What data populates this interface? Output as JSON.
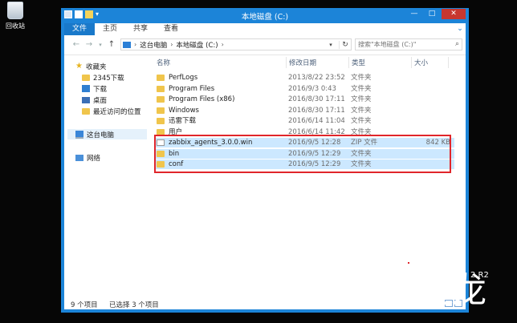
{
  "desktop": {
    "recycle_bin_label": "回收站"
  },
  "window": {
    "title": "本地磁盘 (C:)",
    "ribbon_tabs": [
      "文件",
      "主页",
      "共享",
      "查看"
    ],
    "address": {
      "crumbs": [
        "这台电脑",
        "本地磁盘 (C:)"
      ]
    },
    "search_placeholder": "搜索\"本地磁盘 (C:)\""
  },
  "nav_pane": {
    "favorites": "收藏夹",
    "items": [
      "2345下载",
      "下载",
      "桌面",
      "最近访问的位置"
    ],
    "this_pc": "这台电脑",
    "network": "网络"
  },
  "columns": {
    "name": "名称",
    "date": "修改日期",
    "type": "类型",
    "size": "大小"
  },
  "files": [
    {
      "name": "PerfLogs",
      "date": "2013/8/22 23:52",
      "type": "文件夹",
      "size": "",
      "icon": "folder-icon",
      "selected": false
    },
    {
      "name": "Program Files",
      "date": "2016/9/3 0:43",
      "type": "文件夹",
      "size": "",
      "icon": "folder-icon",
      "selected": false
    },
    {
      "name": "Program Files (x86)",
      "date": "2016/8/30 17:11",
      "type": "文件夹",
      "size": "",
      "icon": "folder-icon",
      "selected": false
    },
    {
      "name": "Windows",
      "date": "2016/8/30 17:11",
      "type": "文件夹",
      "size": "",
      "icon": "folder-icon",
      "selected": false
    },
    {
      "name": "迅雷下载",
      "date": "2016/6/14 11:04",
      "type": "文件夹",
      "size": "",
      "icon": "folder-icon",
      "selected": false
    },
    {
      "name": "用户",
      "date": "2016/6/14 11:42",
      "type": "文件夹",
      "size": "",
      "icon": "folder-icon",
      "selected": false
    },
    {
      "name": "zabbix_agents_3.0.0.win",
      "date": "2016/9/5 12:28",
      "type": "ZIP 文件",
      "size": "842 KB",
      "icon": "zip-file-icon",
      "selected": true
    },
    {
      "name": "bin",
      "date": "2016/9/5 12:29",
      "type": "文件夹",
      "size": "",
      "icon": "folder-icon",
      "selected": true
    },
    {
      "name": "conf",
      "date": "2016/9/5 12:29",
      "type": "文件夹",
      "size": "",
      "icon": "folder-icon",
      "selected": true
    }
  ],
  "status": {
    "item_count": "9 个项目",
    "selected_count": "已选择 3 个项目"
  },
  "watermark": {
    "text": "高文龙",
    "sub": "2 R2"
  },
  "colors": {
    "title_bar": "#1c84d8",
    "selection": "#cce8ff",
    "highlight_box": "#e0262b"
  }
}
